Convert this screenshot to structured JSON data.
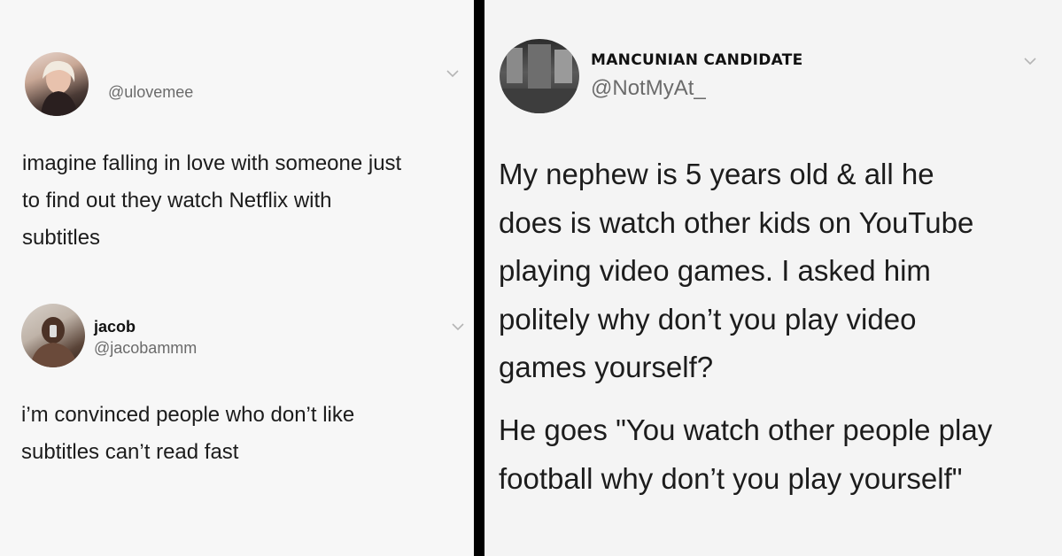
{
  "tweet1": {
    "handle": "@ulovemee",
    "lines": [
      "imagine falling in love with someone just",
      "to find out they watch Netflix with",
      "subtitles"
    ]
  },
  "tweet2": {
    "name": "jacob",
    "handle": "@jacobammm",
    "lines": [
      "i’m convinced people who don’t like",
      "subtitles can’t read fast"
    ]
  },
  "tweet3": {
    "name": "MANCUNIAN CANDIDATE",
    "handle": "@NotMyAt_",
    "para1": [
      "My nephew is 5 years old & all he",
      "does is watch other kids on YouTube",
      "playing video games. I asked him",
      "politely why don’t you play video",
      "games yourself?"
    ],
    "para2": [
      "He goes \"You watch other people play",
      "football why don’t you play yourself\""
    ]
  },
  "icons": {
    "menu": "chevron-down-icon"
  },
  "colors": {
    "divider": "#000000",
    "text": "#1c1c1c",
    "handle": "#6b6b6b"
  }
}
